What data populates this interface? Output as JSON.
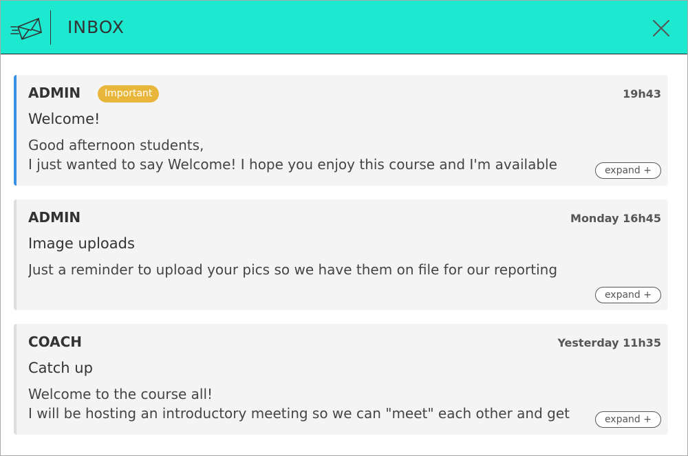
{
  "header": {
    "title": "INBOX",
    "icon": "send-mail-icon",
    "close_icon": "close-icon",
    "background": "#1de9d0"
  },
  "messages": [
    {
      "sender": "ADMIN",
      "badge": "Important",
      "time": "19h43",
      "subject": "Welcome!",
      "body_line1": "Good afternoon students,",
      "body_line2": "I just wanted to say Welcome! I hope you enjoy this course and I'm available",
      "expand_label": "expand +",
      "accent": "#3a92e6"
    },
    {
      "sender": "ADMIN",
      "time": "Monday 16h45",
      "subject": "Image uploads",
      "body_line1": "Just a reminder to upload your pics so we have them on file for our reporting",
      "expand_label": "expand +"
    },
    {
      "sender": "COACH",
      "time": "Yesterday 11h35",
      "subject": "Catch up",
      "body_line1": "Welcome to the course all!",
      "body_line2": "I will be hosting an introductory meeting so we can \"meet\" each other and get",
      "expand_label": "expand +"
    }
  ],
  "colors": {
    "badge": "#e8b63a",
    "card_background": "#f4f4f4",
    "unread_accent": "#3a92e6"
  }
}
